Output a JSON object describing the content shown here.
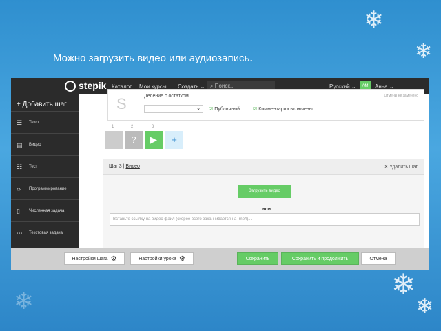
{
  "slide": {
    "title": "Можно загрузить видео или аудиозапись."
  },
  "topnav": {
    "logo": "stepik",
    "items": [
      "Каталог",
      "Мои курсы",
      "Создать ⌄"
    ],
    "search_placeholder": "Поиск...",
    "language": "Русский ⌄",
    "avatar": "АМ",
    "user": "Анна ⌄"
  },
  "sidebar": {
    "add_step": "+ Добавить шаг",
    "items": [
      {
        "label": "Текст",
        "icon": "text-icon"
      },
      {
        "label": "Видео",
        "icon": "video-icon"
      },
      {
        "label": "Тест",
        "icon": "quiz-icon"
      },
      {
        "label": "Программирование",
        "icon": "code-icon"
      },
      {
        "label": "Численная задача",
        "icon": "number-icon"
      },
      {
        "label": "Текстовая задача",
        "icon": "text-task-icon"
      }
    ]
  },
  "lesson": {
    "title": "Деление с остатком",
    "hint": "Отмены не заменено",
    "select_value": "—",
    "public_label": "Публичный",
    "comments_label": "Комментарии включены"
  },
  "steps": {
    "numbers": [
      "1",
      "2",
      "3"
    ],
    "unknown_glyph": "?",
    "add_glyph": "+"
  },
  "step_panel": {
    "step_label": "Шаг 3",
    "type_label": "Видео",
    "delete_label": "Удалить шаг",
    "upload_label": "Загрузить видео",
    "or_label": "или",
    "url_placeholder": "Вставьте ссылку на видео файл (скорее всего заканчивается на .mp4)..."
  },
  "bottombar": {
    "step_settings": "Настройки шага",
    "lesson_settings": "Настройки урока",
    "save": "Сохранить",
    "save_continue": "Сохранить и продолжить",
    "cancel": "Отмена"
  }
}
